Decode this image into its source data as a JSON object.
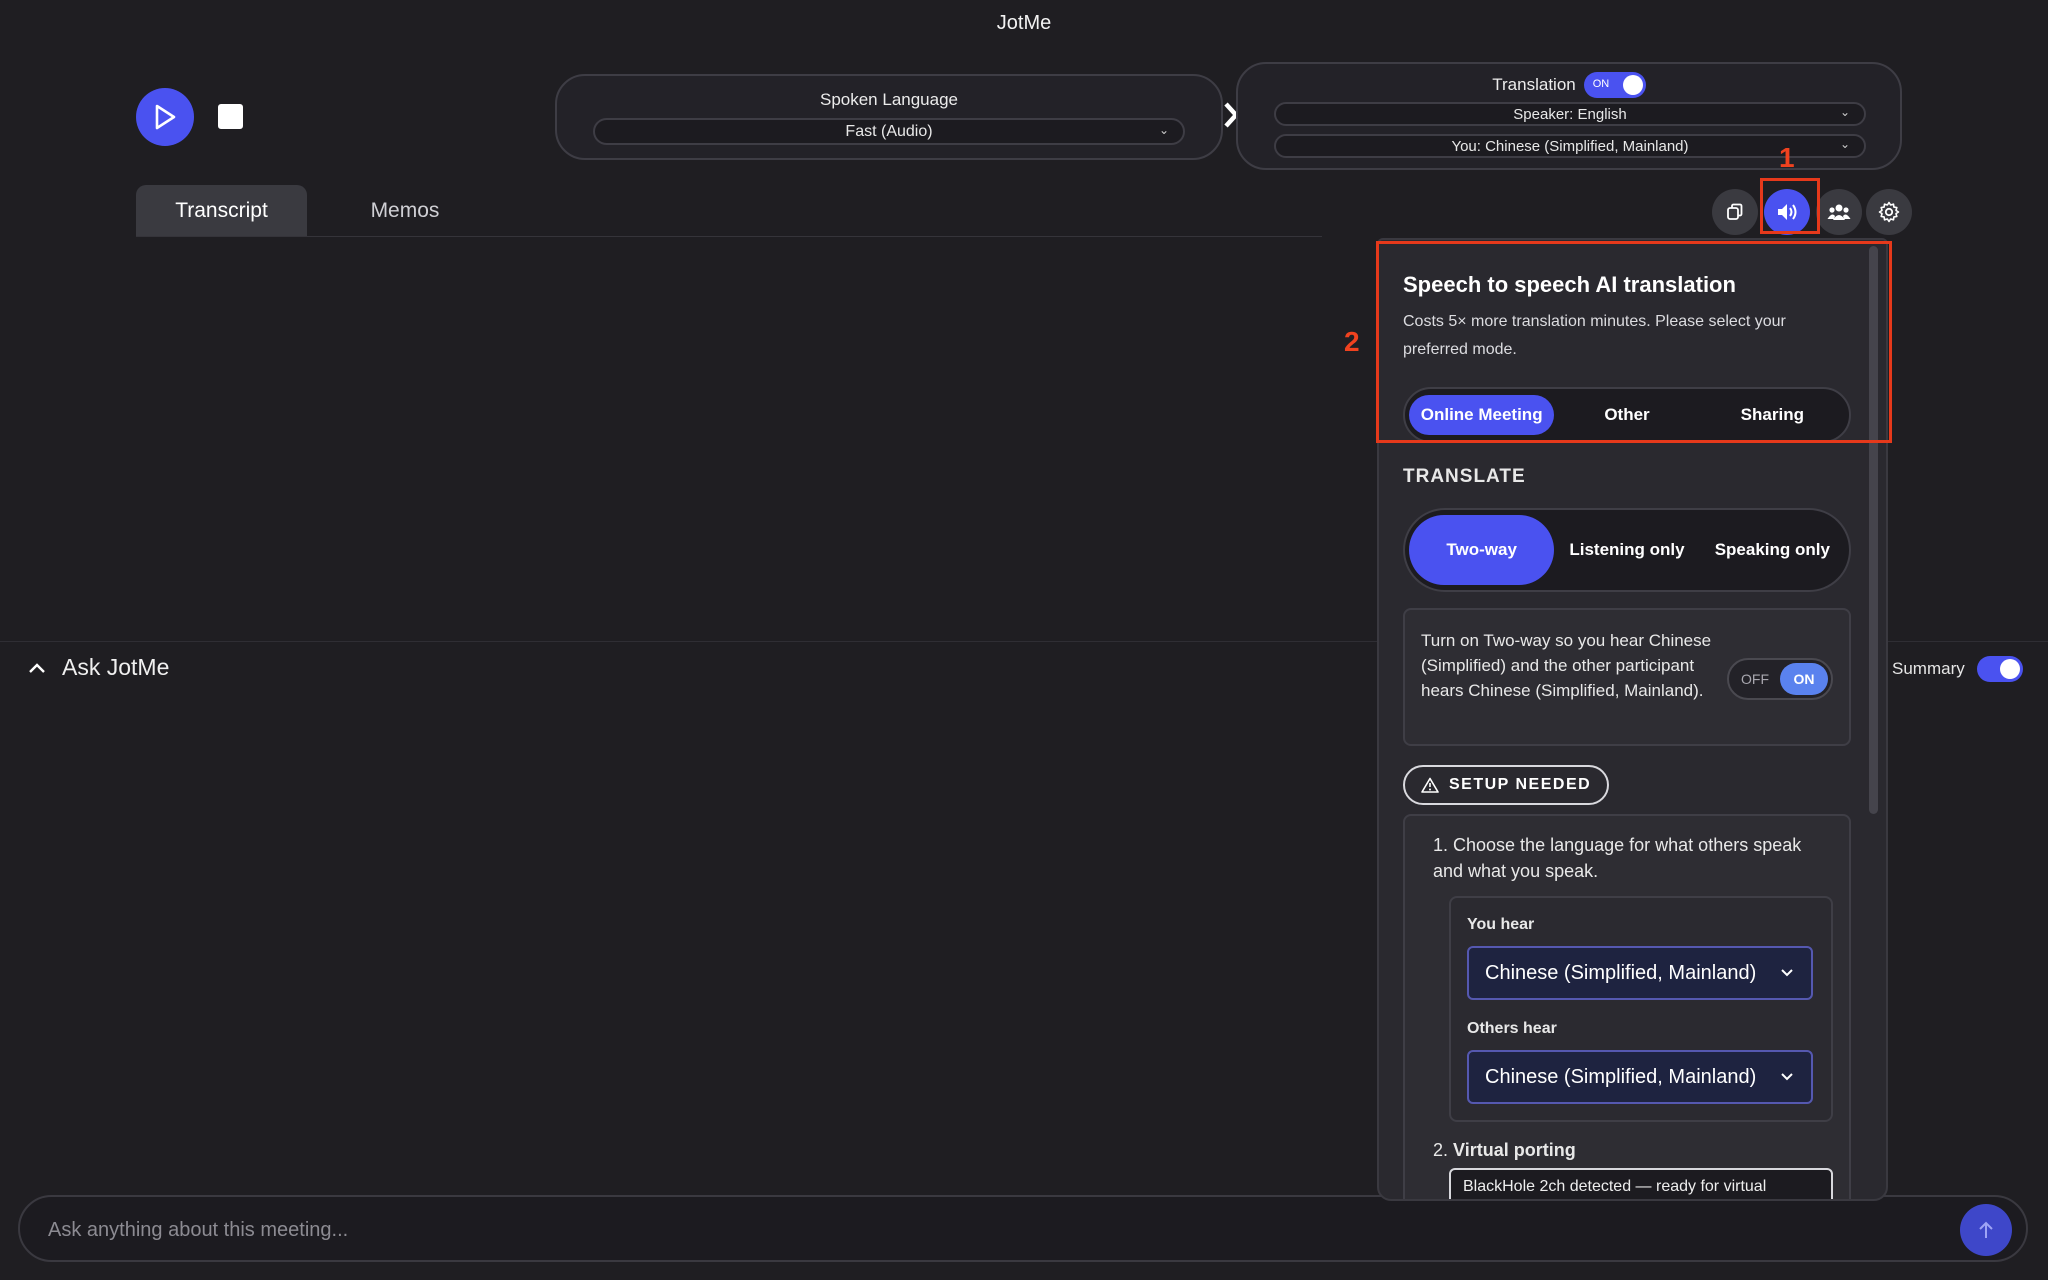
{
  "app": {
    "title": "JotMe"
  },
  "spoken": {
    "label": "Spoken Language",
    "value": "Fast (Audio)"
  },
  "translation": {
    "label": "Translation",
    "toggle": "ON",
    "speaker": "Speaker: English",
    "you": "You: Chinese (Simplified, Mainland)"
  },
  "tabs": [
    {
      "label": "Transcript"
    },
    {
      "label": "Memos"
    }
  ],
  "annotations": {
    "one": "1",
    "two": "2",
    "color": "#e6391b"
  },
  "panel": {
    "title": "Speech to speech AI translation",
    "desc": "Costs 5× more translation minutes. Please select your preferred mode.",
    "modes": [
      "Online Meeting",
      "Other",
      "Sharing"
    ],
    "mode_selected": "Online Meeting",
    "section": "TRANSLATE",
    "translate_opts": [
      "Two-way",
      "Listening only",
      "Speaking only"
    ],
    "translate_selected": "Two-way",
    "info": "Turn on Two-way so you hear Chinese (Simplified) and the other participant hears Chinese (Simplified, Mainland).",
    "info_toggle_off": "OFF",
    "info_toggle_on": "ON",
    "setup": "SETUP NEEDED",
    "step1": "1. Choose the language for what others speak and what you speak.",
    "you_hear_label": "You hear",
    "you_hear_value": "Chinese (Simplified, Mainland)",
    "others_hear_label": "Others hear",
    "others_hear_value": "Chinese (Simplified, Mainland)",
    "step2_num": "2.",
    "step2_title": "Virtual porting",
    "virtual_text": "BlackHole 2ch detected — ready for virtual"
  },
  "ask": {
    "title": "Ask JotMe",
    "summary_label": "Summary",
    "placeholder": "Ask anything about this meeting..."
  },
  "colors": {
    "accent": "#4a52f0",
    "bg": "#1f1e22",
    "panel": "#2a292f"
  }
}
